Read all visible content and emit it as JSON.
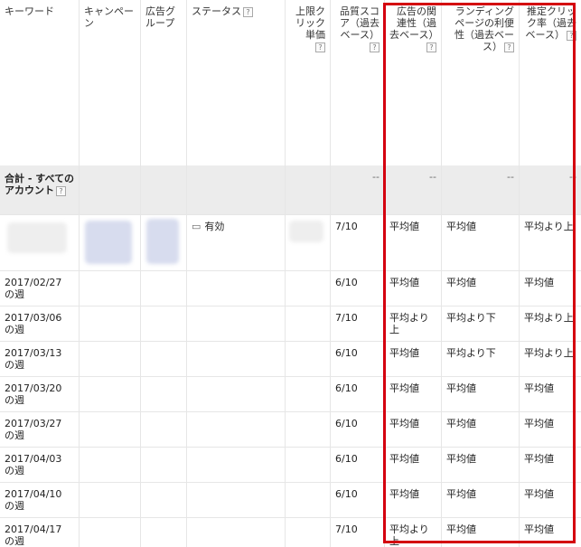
{
  "header": {
    "keyword": "キーワード",
    "campaign": "キャンペーン",
    "ad_group": "広告グループ",
    "status": "ステータス",
    "max_cpc": "上限クリック単価",
    "quality_score": "品質スコア（過去ベース）",
    "ad_relevance": "広告の関連性（過去ベース）",
    "landing_page": "ランディングページの利便性（過去ベース）",
    "expected_ctr": "推定クリック率（過去ベース）",
    "help_glyph": "?"
  },
  "total": {
    "label": "合計 - すべてのアカウント",
    "dash": "--"
  },
  "first_row": {
    "status_text": "有効",
    "quality_score": "7/10",
    "ad_relevance": "平均値",
    "landing_page": "平均値",
    "expected_ctr": "平均より上"
  },
  "rows": [
    {
      "week": "2017/02/27 の週",
      "quality_score": "6/10",
      "ad_relevance": "平均値",
      "landing_page": "平均値",
      "expected_ctr": "平均値"
    },
    {
      "week": "2017/03/06 の週",
      "quality_score": "7/10",
      "ad_relevance": "平均より上",
      "landing_page": "平均より下",
      "expected_ctr": "平均より上"
    },
    {
      "week": "2017/03/13 の週",
      "quality_score": "6/10",
      "ad_relevance": "平均値",
      "landing_page": "平均より下",
      "expected_ctr": "平均より上"
    },
    {
      "week": "2017/03/20 の週",
      "quality_score": "6/10",
      "ad_relevance": "平均値",
      "landing_page": "平均値",
      "expected_ctr": "平均値"
    },
    {
      "week": "2017/03/27 の週",
      "quality_score": "6/10",
      "ad_relevance": "平均値",
      "landing_page": "平均値",
      "expected_ctr": "平均値"
    },
    {
      "week": "2017/04/03 の週",
      "quality_score": "6/10",
      "ad_relevance": "平均値",
      "landing_page": "平均値",
      "expected_ctr": "平均値"
    },
    {
      "week": "2017/04/10 の週",
      "quality_score": "6/10",
      "ad_relevance": "平均値",
      "landing_page": "平均値",
      "expected_ctr": "平均値"
    },
    {
      "week": "2017/04/17 の週",
      "quality_score": "7/10",
      "ad_relevance": "平均より上",
      "landing_page": "平均値",
      "expected_ctr": "平均値"
    }
  ],
  "colors": {
    "highlight_border": "#d4000f",
    "total_row_bg": "#ececec",
    "grid_line": "#e6e6e6"
  }
}
